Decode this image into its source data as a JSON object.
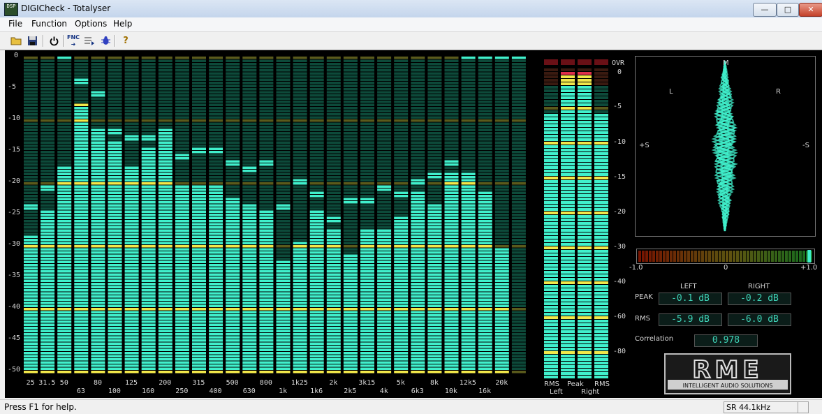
{
  "window": {
    "title": "DIGICheck - Totalyser",
    "icon_text": "DSP",
    "minimize_icon": "minimize-icon",
    "maximize_icon": "maximize-icon",
    "close_icon": "close-icon"
  },
  "menu": [
    "File",
    "Function",
    "Options",
    "Help"
  ],
  "toolbar": {
    "icons": [
      "open-folder-icon",
      "save-icon",
      "power-icon",
      "fnc-icon",
      "settings-icon",
      "bug-icon",
      "help-icon"
    ],
    "fnc_label": "FNC"
  },
  "colors": {
    "bar_lit": "#40f0cc",
    "bar_unlit": "#0d4a3a",
    "bar_peak_band": "#f2e84a",
    "bar_unlit_band": "#5a5a1c",
    "overload": "#e0304a"
  },
  "spectrum": {
    "db_scale": [
      "0",
      "-5",
      "-10",
      "-15",
      "-20",
      "-25",
      "-30",
      "-35",
      "-40",
      "-45",
      "-50"
    ],
    "bands_upper": [
      "25",
      "50",
      "80",
      "125",
      "200",
      "315",
      "500",
      "800",
      "1k25",
      "2k",
      "3k15",
      "5k",
      "8k",
      "12k5",
      "20k"
    ],
    "bands_lower": [
      "31.5",
      "63",
      "100",
      "160",
      "250",
      "400",
      "630",
      "1k",
      "1k6",
      "2k5",
      "4k",
      "6k3",
      "10k",
      "16k"
    ],
    "levels_db": [
      -28.5,
      -24.5,
      -17.5,
      -7.5,
      -11.5,
      -13.5,
      -17.5,
      -14.5,
      -12.5,
      -20.5,
      -20.5,
      -20.5,
      -22.5,
      -23.5,
      -24.5,
      -32.5,
      -29.5,
      -24.5,
      -27.5,
      -31.5,
      -27.5,
      -27.5,
      -25.5,
      -21.5,
      -23.5,
      -18.5,
      -18.5,
      -21.5,
      -30.5,
      -50.5
    ],
    "peaks_db": [
      -23.5,
      -20.5,
      null,
      -3.5,
      -5.5,
      -11.5,
      -12.5,
      -12.5,
      -11.5,
      -15.5,
      -14.5,
      -14.5,
      -16.5,
      -17.5,
      -16.5,
      -23.5,
      -19.5,
      -21.5,
      -25.5,
      -22.5,
      -22.5,
      -20.5,
      -21.5,
      -19.5,
      -18.5,
      -16.5,
      null,
      null,
      null,
      null
    ]
  },
  "level_meters": {
    "db_scale": [
      "OVR",
      "0",
      "-5",
      "-10",
      "-15",
      "-20",
      "-30",
      "-40",
      "-60",
      "-80"
    ],
    "labels_top": [
      "RMS",
      "Peak",
      "RMS"
    ],
    "labels_bottom": [
      "Left",
      "Right"
    ],
    "left_rms_db": -5.9,
    "left_peak_db": -0.1,
    "right_peak_db": -0.2,
    "right_rms_db": -6.0
  },
  "goniometer": {
    "labels": {
      "m": "M",
      "l": "L",
      "r": "R",
      "plus_s": "+S",
      "minus_s": "-S"
    }
  },
  "correlation_meter": {
    "scale": [
      "-1.0",
      "0",
      "+1.0"
    ],
    "value": 0.978
  },
  "readouts": {
    "left_header": "LEFT",
    "right_header": "RIGHT",
    "peak_label": "PEAK",
    "rms_label": "RMS",
    "corr_label": "Correlation",
    "peak_left": "-0.1 dB",
    "peak_right": "-0.2 dB",
    "rms_left": "-5.9 dB",
    "rms_right": "-6.0 dB",
    "correlation": "0.978"
  },
  "logo": {
    "brand": "RME",
    "tagline": "INTELLIGENT AUDIO SOLUTIONS"
  },
  "status": {
    "text": "Press F1 for help.",
    "sample_rate": "SR 44.1kHz"
  }
}
